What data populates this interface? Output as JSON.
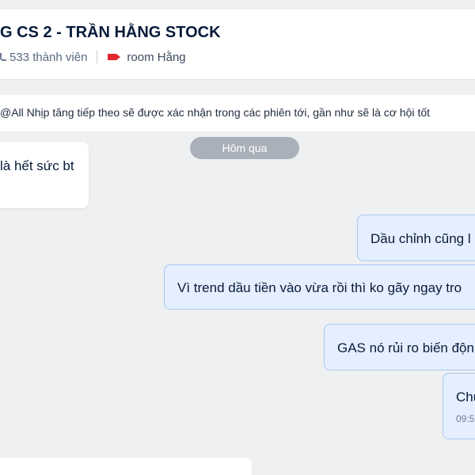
{
  "header": {
    "title": "G CS 2 - TRẦN HẰNG STOCK",
    "members": "533 thành viên",
    "room_label": "room Hằng",
    "room_tag_color": "#e0272a",
    "member_icon": "person-icon",
    "tag_icon": "tag-icon"
  },
  "pinned": {
    "text": "@All Nhịp tăng tiếp theo sẽ được xác nhận trong các phiên tới, gần như sẽ là cơ hội tốt"
  },
  "date_divider": "Hôm qua",
  "messages": {
    "incoming": [
      {
        "text": "là hết sức bt"
      }
    ],
    "outgoing": [
      {
        "text": "Dầu chỉnh cũng l"
      },
      {
        "text": "Vì trend dầu tiền vào vừa rồi thì ko gãy ngay tro"
      },
      {
        "text": "GAS nó rủi ro biến độn"
      },
      {
        "text": "Chu",
        "time": "09:5"
      }
    ]
  },
  "colors": {
    "background": "#eef0f2",
    "outgoing_bubble": "#e5efff",
    "outgoing_border": "#a9c8f2",
    "divider_chip": "#a9b0b9"
  }
}
